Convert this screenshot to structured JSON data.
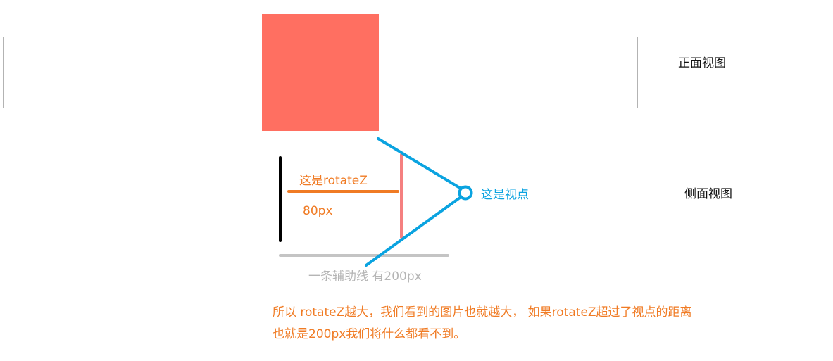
{
  "labels": {
    "front_view": "正面视图",
    "side_view": "侧面视图",
    "rotate_z": "这是rotateZ",
    "distance": "80px",
    "viewpoint": "这是视点",
    "helper_line": "一条辅助线 有200px"
  },
  "explanation": {
    "line1": "所以 rotateZ越大，我们看到的图片也就越大， 如果rotateZ超过了视点的距离",
    "line2": "也就是200px我们将什么都看不到。"
  },
  "colors": {
    "image_square": "#ff6f61",
    "image_edge": "#f58080",
    "orange": "#f07b24",
    "blue": "#0aa3e0",
    "helper_gray": "#c4c4c4",
    "frame_gray": "#b3b3b3",
    "screen_black": "#000000"
  }
}
